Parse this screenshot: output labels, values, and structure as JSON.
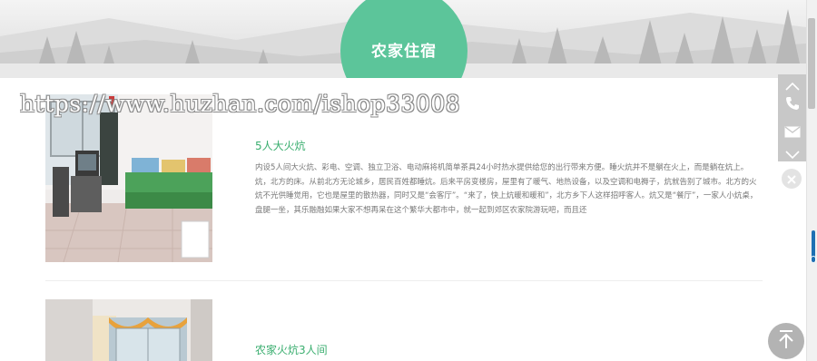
{
  "header": {
    "section_title": "农家住宿"
  },
  "watermark": {
    "text": "https://www.huzhan.com/ishop33008"
  },
  "rooms": [
    {
      "title": "5人大火炕",
      "description": "内设5人间大火炕、彩电、空调、独立卫浴、电动麻将机简单茶具24小时热水提供给您的出行带来方便。睡火炕并不是躺在火上，而是躺在炕上。炕，北方的床。从前北方无论城乡，居民百姓都睡炕。后来平房变楼房，屋里有了暖气、地热设备，以及空调和电褥子，炕就告别了城市。北方的火炕不光供睡觉用，它也是屋里的散热器，同时又是“会客厅”。“来了，快上炕暖和暖和”，北方乡下人这样招呼客人。炕又是“餐厅”，一家人小炕桌，盘腿一坐，其乐融融如果大家不想再呆在这个繁华大都市中，就一起到郊区农家院游玩吧，而且还"
    },
    {
      "title": "农家火炕3人间",
      "description": ""
    }
  ],
  "side_toolbar": {
    "icons": [
      "chevron-up-icon",
      "phone-icon",
      "mail-icon",
      "chevron-down-icon",
      "close-icon",
      "back-to-top-icon"
    ]
  },
  "colors": {
    "accent_green": "#5cc59a",
    "title_green": "#3aae6f",
    "body_text": "#777777",
    "side_bar": "#c8c8c8"
  }
}
